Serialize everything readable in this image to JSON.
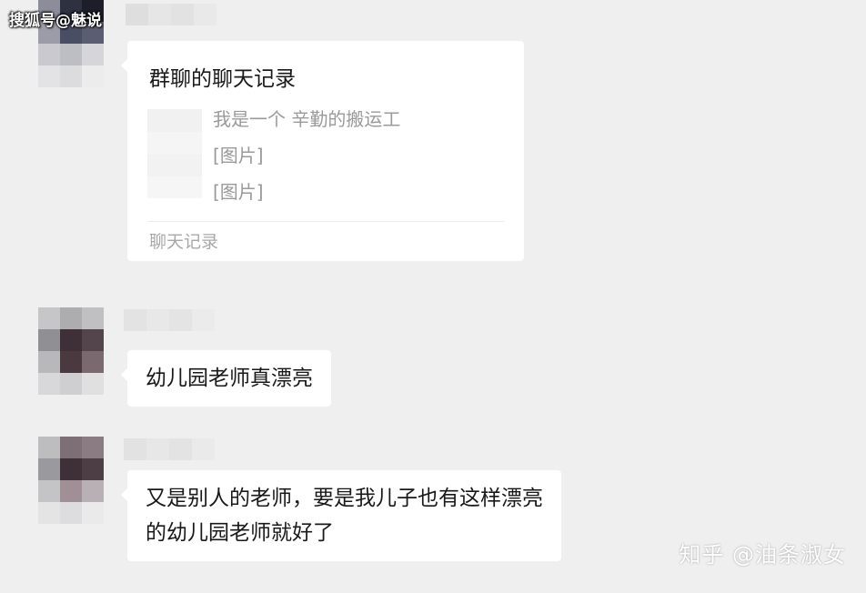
{
  "watermarks": {
    "top": "搜狐号@魅说",
    "bottom": "知乎 @油条淑女"
  },
  "messages": [
    {
      "type": "chat_record",
      "title": "群聊的聊天记录",
      "lines": [
        "我是一个 辛勤的搬运工",
        "[图片]",
        "[图片]"
      ],
      "footer": "聊天记录"
    },
    {
      "type": "text",
      "text": "幼儿园老师真漂亮"
    },
    {
      "type": "text",
      "text_line1": "又是别人的老师，要是我儿子也有这样漂亮",
      "text_line2": "的幼儿园老师就好了"
    }
  ],
  "colors": {
    "background": "#efefef",
    "bubble": "#ffffff",
    "text": "#191919",
    "muted": "#9a9a9a"
  }
}
